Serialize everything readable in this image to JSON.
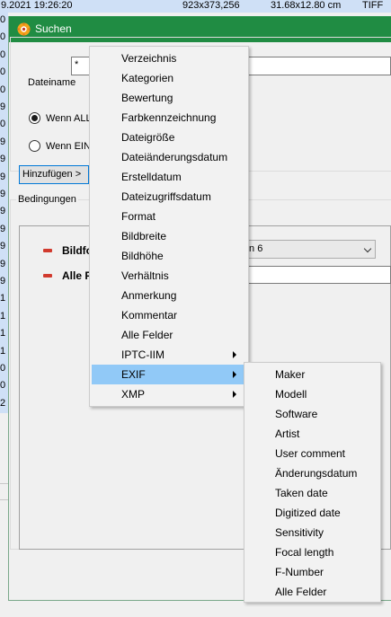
{
  "background": {
    "row": {
      "date": "9.2021 19:26:20",
      "resolution": "923x373,256",
      "size_cm": "31.68x12.80 cm",
      "format": "TIFF"
    },
    "left_digits": [
      "0",
      "0",
      "0",
      "0",
      "0",
      "9",
      "0",
      "9",
      "9",
      "9",
      "9",
      "9",
      "9",
      "9",
      "9",
      "9",
      "1",
      "1",
      "1",
      "1",
      "0",
      "0",
      "2"
    ]
  },
  "dialog": {
    "title": "Suchen",
    "filename_label": "Dateiname",
    "filename_value": "*",
    "radio_all_label": "Wenn ALL",
    "radio_any_label": "Wenn EIN",
    "radio_all_checked": true,
    "add_button_label": "Hinzufügen >",
    "conditions_title": "Bedingungen",
    "conditions": [
      {
        "label": "Bildfo"
      },
      {
        "label": "Alle F"
      }
    ],
    "combo_value": "sion 6",
    "condition_input_value": ""
  },
  "menu": {
    "items": [
      {
        "label": "Verzeichnis",
        "submenu": false
      },
      {
        "label": "Kategorien",
        "submenu": false
      },
      {
        "label": "Bewertung",
        "submenu": false
      },
      {
        "label": "Farbkennzeichnung",
        "submenu": false
      },
      {
        "label": "Dateigröße",
        "submenu": false
      },
      {
        "label": "Dateiänderungsdatum",
        "submenu": false
      },
      {
        "label": "Erstelldatum",
        "submenu": false
      },
      {
        "label": "Dateizugriffsdatum",
        "submenu": false
      },
      {
        "label": "Format",
        "submenu": false
      },
      {
        "label": "Bildbreite",
        "submenu": false
      },
      {
        "label": "Bildhöhe",
        "submenu": false
      },
      {
        "label": "Verhältnis",
        "submenu": false
      },
      {
        "label": "Anmerkung",
        "submenu": false
      },
      {
        "label": "Kommentar",
        "submenu": false
      },
      {
        "label": "Alle Felder",
        "submenu": false
      },
      {
        "label": "IPTC-IIM",
        "submenu": true
      },
      {
        "label": "EXIF",
        "submenu": true,
        "highlighted": true
      },
      {
        "label": "XMP",
        "submenu": true
      }
    ]
  },
  "exif_submenu": {
    "items": [
      {
        "label": "Maker"
      },
      {
        "label": "Modell"
      },
      {
        "label": "Software"
      },
      {
        "label": "Artist"
      },
      {
        "label": "User comment"
      },
      {
        "label": "Änderungsdatum"
      },
      {
        "label": "Taken date"
      },
      {
        "label": "Digitized date"
      },
      {
        "label": "Sensitivity"
      },
      {
        "label": "Focal length"
      },
      {
        "label": "F-Number"
      },
      {
        "label": "Alle Felder"
      }
    ]
  },
  "colors": {
    "titlebar": "#208c43",
    "menu_highlight": "#91c9f7",
    "condition_remove": "#d13a2e",
    "list_selection": "#cfe0f6"
  },
  "icons": {
    "app": "xnview-app-icon",
    "remove": "minus-icon",
    "submenu": "submenu-arrow-icon",
    "dropdown": "chevron-down-icon"
  }
}
